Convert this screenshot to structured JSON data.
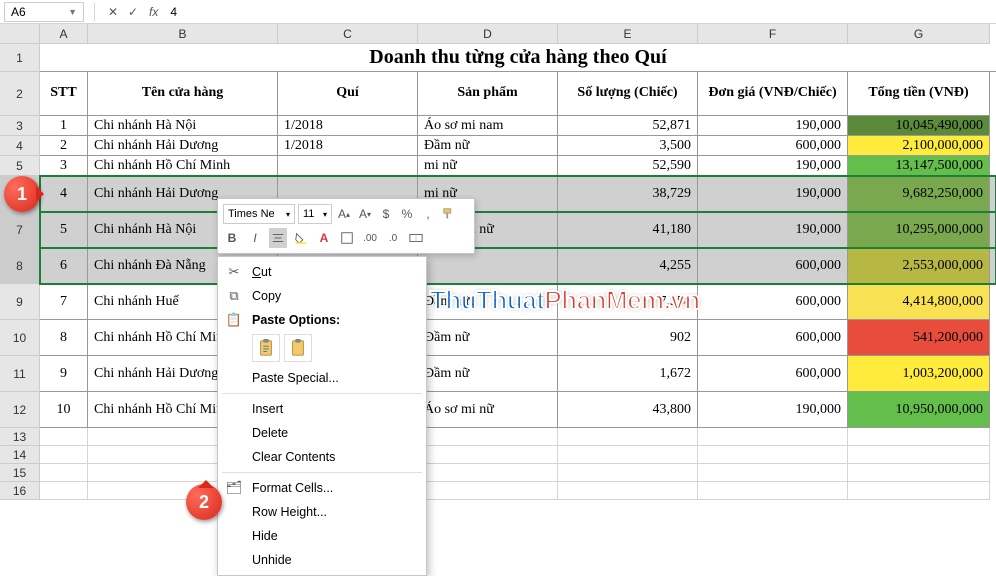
{
  "namebox": {
    "ref": "A6",
    "formula": "4"
  },
  "columns": [
    "A",
    "B",
    "C",
    "D",
    "E",
    "F",
    "G"
  ],
  "row_labels": [
    "1",
    "2",
    "3",
    "4",
    "5",
    "6",
    "7",
    "8",
    "9",
    "10",
    "11",
    "12",
    "13",
    "14",
    "15",
    "16"
  ],
  "title": "Doanh thu từng cửa hàng theo Quí",
  "headers": {
    "stt": "STT",
    "ten": "Tên cửa hàng",
    "qui": "Quí",
    "sp": "Sản phẩm",
    "sl": "Số lượng (Chiếc)",
    "dg": "Đơn giá (VNĐ/Chiếc)",
    "tt": "Tổng tiền (VNĐ)"
  },
  "rows": [
    {
      "stt": "1",
      "ten": "Chi nhánh Hà Nội",
      "qui": "1/2018",
      "sp": "Áo sơ mi nam",
      "sl": "52,871",
      "dg": "190,000",
      "tt": "10,045,490,000",
      "cs": "cs-deep"
    },
    {
      "stt": "2",
      "ten": "Chi nhánh Hải Dương",
      "qui": "1/2018",
      "sp": "Đầm nữ",
      "sl": "3,500",
      "dg": "600,000",
      "tt": "2,100,000,000",
      "cs": "cs-yellow"
    },
    {
      "stt": "3",
      "ten": "Chi nhánh Hồ Chí Minh",
      "qui": "",
      "sp": "mi nữ",
      "sl": "52,590",
      "dg": "190,000",
      "tt": "13,147,500,000",
      "cs": "cs-green"
    },
    {
      "stt": "4",
      "ten": "Chi nhánh Hải Dương",
      "qui": "",
      "sp": "mi nữ",
      "sl": "38,729",
      "dg": "190,000",
      "tt": "9,682,250,000",
      "cs": "cs-med"
    },
    {
      "stt": "5",
      "ten": "Chi nhánh Hà Nội",
      "qui": "",
      "sp": "Áo sơ mi nữ",
      "sl": "41,180",
      "dg": "190,000",
      "tt": "10,295,000,000",
      "cs": "cs-med"
    },
    {
      "stt": "6",
      "ten": "Chi nhánh Đà Nẵng",
      "qui": "",
      "sp": "",
      "sl": "4,255",
      "dg": "600,000",
      "tt": "2,553,000,000",
      "cs": "cs-olive"
    },
    {
      "stt": "7",
      "ten": "Chi nhánh Huế",
      "qui": "",
      "sp": "Đầm nữ",
      "sl": "7,358",
      "dg": "600,000",
      "tt": "4,414,800,000",
      "cs": "cs-ly"
    },
    {
      "stt": "8",
      "ten": "Chi nhánh Hồ Chí Minh",
      "qui": "",
      "sp": "Đầm nữ",
      "sl": "902",
      "dg": "600,000",
      "tt": "541,200,000",
      "cs": "cs-red"
    },
    {
      "stt": "9",
      "ten": "Chi nhánh Hải Dương",
      "qui": "",
      "sp": "Đầm nữ",
      "sl": "1,672",
      "dg": "600,000",
      "tt": "1,003,200,000",
      "cs": "cs-yellow"
    },
    {
      "stt": "10",
      "ten": "Chi nhánh Hồ Chí Minh",
      "qui": "",
      "sp": "Áo sơ mi nữ",
      "sl": "43,800",
      "dg": "190,000",
      "tt": "10,950,000,000",
      "cs": "cs-green"
    }
  ],
  "mini_toolbar": {
    "font": "Times Ne",
    "size": "11"
  },
  "context_menu": {
    "cut": "Cut",
    "copy": "Copy",
    "paste_opts": "Paste Options:",
    "paste_special": "Paste Special...",
    "insert": "Insert",
    "delete": "Delete",
    "clear": "Clear Contents",
    "format_cells": "Format Cells...",
    "row_height": "Row Height...",
    "hide": "Hide",
    "unhide": "Unhide"
  },
  "callouts": {
    "c1": "1",
    "c2": "2"
  },
  "watermark": {
    "a": "ThuThuat",
    "b": "PhanMem.vn"
  },
  "chart_data": {
    "type": "table",
    "title": "Doanh thu từng cửa hàng theo Quí",
    "columns": [
      "STT",
      "Tên cửa hàng",
      "Quí",
      "Sản phẩm",
      "Số lượng (Chiếc)",
      "Đơn giá (VNĐ/Chiếc)",
      "Tổng tiền (VNĐ)"
    ],
    "rows": [
      [
        1,
        "Chi nhánh Hà Nội",
        "1/2018",
        "Áo sơ mi nam",
        52871,
        190000,
        10045490000
      ],
      [
        2,
        "Chi nhánh Hải Dương",
        "1/2018",
        "Đầm nữ",
        3500,
        600000,
        2100000000
      ],
      [
        3,
        "Chi nhánh Hồ Chí Minh",
        "",
        "Áo sơ mi nữ",
        52590,
        190000,
        13147500000
      ],
      [
        4,
        "Chi nhánh Hải Dương",
        "",
        "Áo sơ mi nữ",
        38729,
        190000,
        9682250000
      ],
      [
        5,
        "Chi nhánh Hà Nội",
        "",
        "Áo sơ mi nữ",
        41180,
        190000,
        10295000000
      ],
      [
        6,
        "Chi nhánh Đà Nẵng",
        "",
        "",
        4255,
        600000,
        2553000000
      ],
      [
        7,
        "Chi nhánh Huế",
        "",
        "Đầm nữ",
        7358,
        600000,
        4414800000
      ],
      [
        8,
        "Chi nhánh Hồ Chí Minh",
        "",
        "Đầm nữ",
        902,
        600000,
        541200000
      ],
      [
        9,
        "Chi nhánh Hải Dương",
        "",
        "Đầm nữ",
        1672,
        600000,
        1003200000
      ],
      [
        10,
        "Chi nhánh Hồ Chí Minh",
        "",
        "Áo sơ mi nữ",
        43800,
        190000,
        10950000000
      ]
    ]
  }
}
